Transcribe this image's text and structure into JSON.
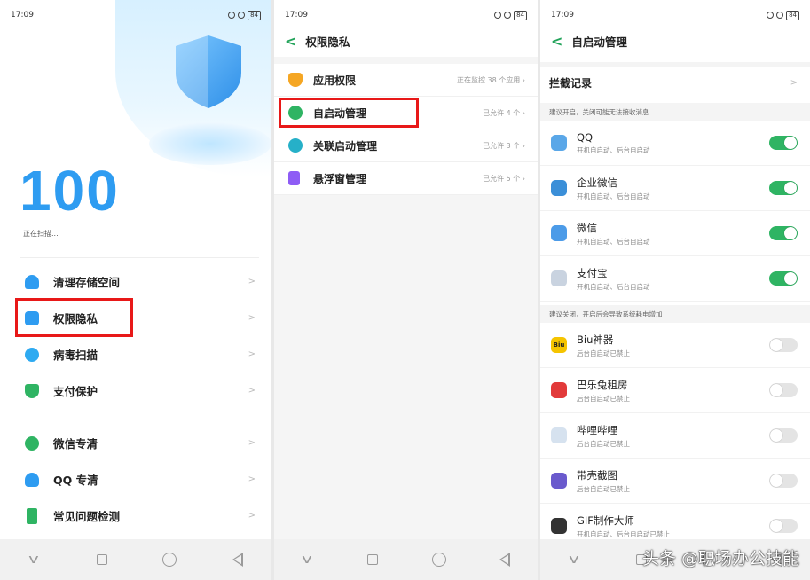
{
  "status": {
    "time": "17:09",
    "battery": "84"
  },
  "screen1": {
    "score": "100",
    "scanning_text": "正在扫描...",
    "menu": [
      {
        "label": "清理存储空间",
        "icon": "rocket-icon",
        "color": "#2e9cf1"
      },
      {
        "label": "权限隐私",
        "icon": "lock-icon",
        "color": "#2e9cf1"
      },
      {
        "label": "病毒扫描",
        "icon": "scan-icon",
        "color": "#2eaaf1"
      },
      {
        "label": "支付保护",
        "icon": "shield-icon",
        "color": "#2fb463"
      }
    ],
    "menu2": [
      {
        "label": "微信专清",
        "icon": "wechat-icon",
        "color": "#2fb463"
      },
      {
        "label": "QQ 专清",
        "icon": "qq-icon",
        "color": "#2e9cf1"
      },
      {
        "label": "常见问题检测",
        "icon": "phone-icon",
        "color": "#2fb463"
      }
    ]
  },
  "screen2": {
    "title": "权限隐私",
    "items": [
      {
        "label": "应用权限",
        "value": "正在监控 38 个应用 ›",
        "color": "#f5a623"
      },
      {
        "label": "自启动管理",
        "value": "已允许 4 个 ›",
        "color": "#2fb463"
      },
      {
        "label": "关联启动管理",
        "value": "已允许 3 个 ›",
        "color": "#26b0c8"
      },
      {
        "label": "悬浮窗管理",
        "value": "已允许 5 个 ›",
        "color": "#8e5cf5"
      }
    ]
  },
  "screen3": {
    "title": "自启动管理",
    "intercept_label": "拦截记录",
    "hint_on": "建议开启，关闭可能无法接收消息",
    "hint_off": "建议关闭，开启后会导致系统耗电增加",
    "apps_on": [
      {
        "name": "QQ",
        "sub": "开机自启动、后台自启动",
        "icon": "qq-icon",
        "color": "#5aa7e8",
        "glyph": ""
      },
      {
        "name": "企业微信",
        "sub": "开机自启动、后台自启动",
        "icon": "wework-icon",
        "color": "#3b8fd8",
        "glyph": ""
      },
      {
        "name": "微信",
        "sub": "开机自启动、后台自启动",
        "icon": "wechat-icon",
        "color": "#4c9be8",
        "glyph": ""
      },
      {
        "name": "支付宝",
        "sub": "开机自启动、后台自启动",
        "icon": "alipay-icon",
        "color": "#c9d3e0",
        "glyph": ""
      }
    ],
    "apps_off": [
      {
        "name": "Biu神器",
        "sub": "后台自启动已禁止",
        "icon": "biu-icon",
        "color": "#f5c400",
        "glyph": "Biu"
      },
      {
        "name": "巴乐兔租房",
        "sub": "后台自启动已禁止",
        "icon": "baletu-icon",
        "color": "#e23a3a",
        "glyph": ""
      },
      {
        "name": "哔哩哔哩",
        "sub": "后台自启动已禁止",
        "icon": "bilibili-icon",
        "color": "#d6e2ef",
        "glyph": ""
      },
      {
        "name": "带壳截图",
        "sub": "后台自启动已禁止",
        "icon": "screenshot-icon",
        "color": "#6a5acd",
        "glyph": ""
      },
      {
        "name": "GIF制作大师",
        "sub": "开机自启动、后台自启动已禁止",
        "icon": "gif-icon",
        "color": "#333333",
        "glyph": ""
      }
    ]
  },
  "watermark": "头条 @职场办公技能"
}
